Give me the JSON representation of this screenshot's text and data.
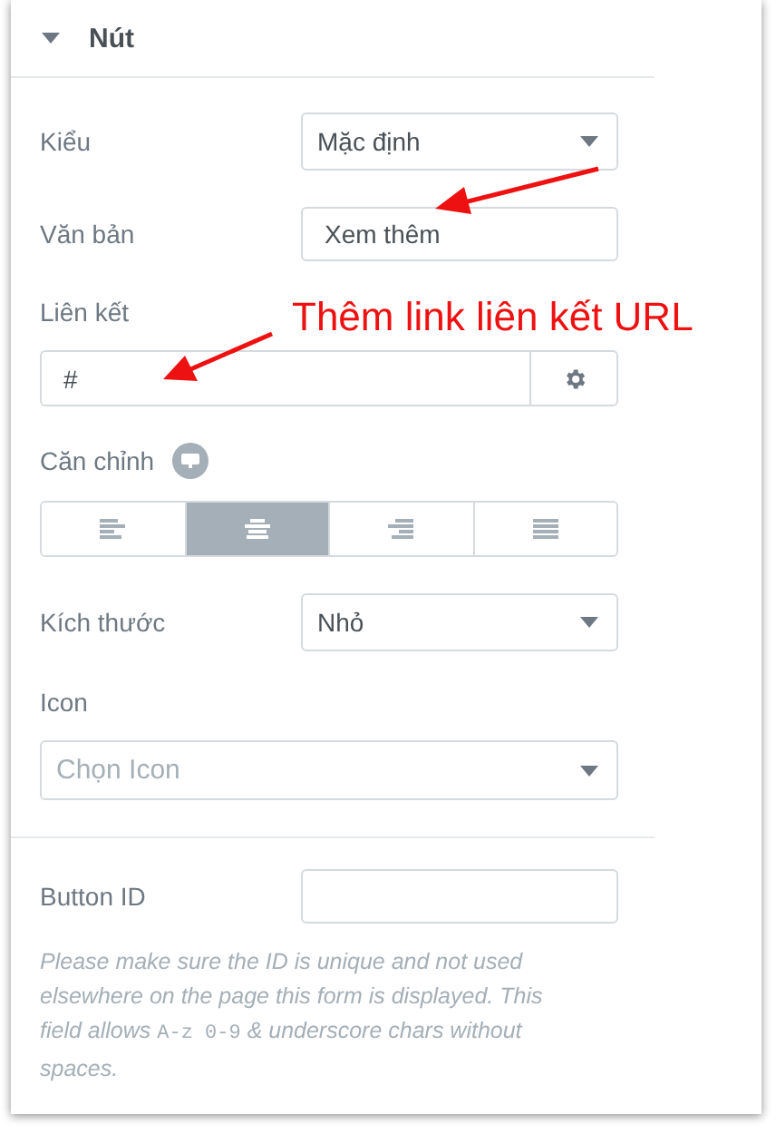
{
  "section": {
    "title": "Nút",
    "expanded": true
  },
  "fields": [
    {
      "kind": "select",
      "label": "Kiểu",
      "value": "Mặc định"
    },
    {
      "kind": "text",
      "label": "Văn bản",
      "value": "Xem thêm"
    },
    {
      "kind": "url",
      "label": "Liên kết",
      "value": "#"
    },
    {
      "kind": "align",
      "label": "Căn chỉnh",
      "options": [
        {
          "kind": "left",
          "selected": false
        },
        {
          "kind": "center",
          "selected": true
        },
        {
          "kind": "right",
          "selected": false
        },
        {
          "kind": "justify",
          "selected": false
        }
      ]
    },
    {
      "kind": "select",
      "label": "Kích thước",
      "value": "Nhỏ"
    },
    {
      "kind": "icon_select",
      "label": "Icon",
      "placeholder": "Chọn Icon"
    }
  ],
  "button_id": {
    "label": "Button ID"
  },
  "note": [
    {
      "kind": "text",
      "text": "Please make sure the ID is unique and not used elsewhere on the page this form is displayed. This field allows "
    },
    {
      "kind": "code",
      "text": "A-z 0-9"
    },
    {
      "kind": "text",
      "text": " & underscore chars without spaces."
    }
  ],
  "annotation": {
    "text": "Thêm link liên kết URL"
  }
}
